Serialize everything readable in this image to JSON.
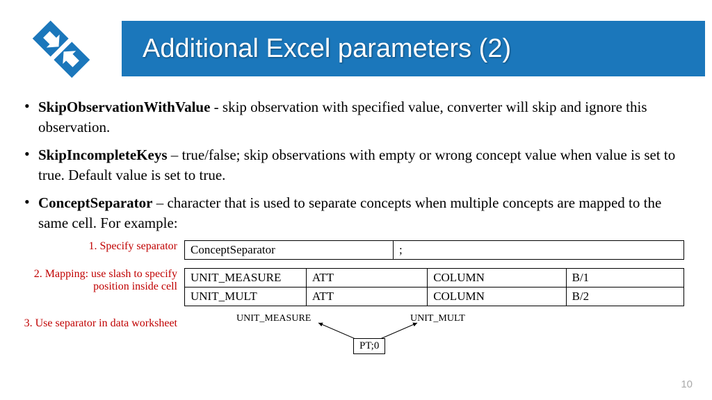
{
  "header": {
    "title": "Additional Excel parameters (2)"
  },
  "bullets": [
    {
      "term": "SkipObservationWithValue",
      "sep": " - ",
      "desc": "skip observation with specified value, converter will skip and ignore this observation."
    },
    {
      "term": "SkipIncompleteKeys",
      "sep": " – ",
      "desc": "true/false; skip observations with empty or wrong concept value when value is set to true. Default value is set to true."
    },
    {
      "term": "ConceptSeparator",
      "sep": " – ",
      "desc": "character that is used to separate concepts when multiple concepts are mapped to the same cell. For example:"
    }
  ],
  "annotations": {
    "a1": "1. Specify separator",
    "a2": "2. Mapping: use slash to specify position inside cell",
    "a3": "3. Use separator in data worksheet"
  },
  "table1": {
    "r0c0": "ConceptSeparator",
    "r0c1": ";"
  },
  "table2": {
    "r0c0": "UNIT_MEASURE",
    "r0c1": "ATT",
    "r0c2": "COLUMN",
    "r0c3": "B/1",
    "r1c0": "UNIT_MULT",
    "r1c1": "ATT",
    "r1c2": "COLUMN",
    "r1c3": "B/2"
  },
  "diagram": {
    "leftLabel": "UNIT_MEASURE",
    "rightLabel": "UNIT_MULT",
    "box": "PT;0"
  },
  "pageNumber": "10"
}
